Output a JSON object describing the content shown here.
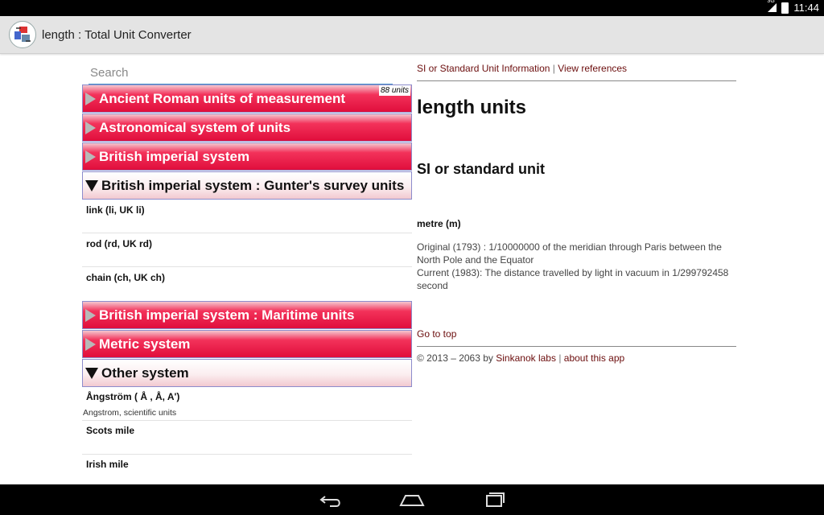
{
  "status": {
    "network": "3G",
    "time": "11:44"
  },
  "app": {
    "title": "length : Total Unit Converter",
    "icon": "converter-app-icon"
  },
  "search": {
    "placeholder": "Search"
  },
  "groups": [
    {
      "label": "Ancient Roman units of measurement",
      "state": "collapsed",
      "badge": "88 units"
    },
    {
      "label": "Astronomical system of units",
      "state": "collapsed"
    },
    {
      "label": "British imperial system",
      "state": "collapsed"
    },
    {
      "label": "British imperial system : Gunter's survey units",
      "state": "expanded",
      "units": [
        {
          "name": "link (li, UK li)"
        },
        {
          "name": "rod (rd, UK rd)"
        },
        {
          "name": "chain (ch, UK ch)"
        }
      ]
    },
    {
      "label": "British imperial system : Maritime units",
      "state": "collapsed"
    },
    {
      "label": "Metric system",
      "state": "collapsed"
    },
    {
      "label": "Other system",
      "state": "expanded",
      "units": [
        {
          "name": "Ångström ( Å , Å, A')",
          "sub": "Angstrom, scientific units"
        },
        {
          "name": "Scots mile"
        },
        {
          "name": "Irish mile"
        }
      ]
    }
  ],
  "info": {
    "link_si": "SI or Standard Unit Information",
    "separator": "|",
    "link_refs": "View references",
    "title": "length units",
    "subtitle": "SI or standard unit",
    "si_unit": "metre (m)",
    "desc_line1": "Original (1793) : 1/10000000 of the meridian through Paris between the North Pole and the Equator",
    "desc_line2": "Current (1983): The distance travelled by light in vacuum in 1/299792458 second",
    "go_top": "Go to top",
    "copyright": "© 2013 – 2063 by ",
    "company": "Sinkanok labs",
    "about": "about this app"
  },
  "colors": {
    "group_red": "#e00e3c",
    "link": "#6b0d0d",
    "search_underline": "#4a90c8"
  },
  "nav": {
    "back": "back-icon",
    "home": "home-icon",
    "recents": "recents-icon"
  }
}
